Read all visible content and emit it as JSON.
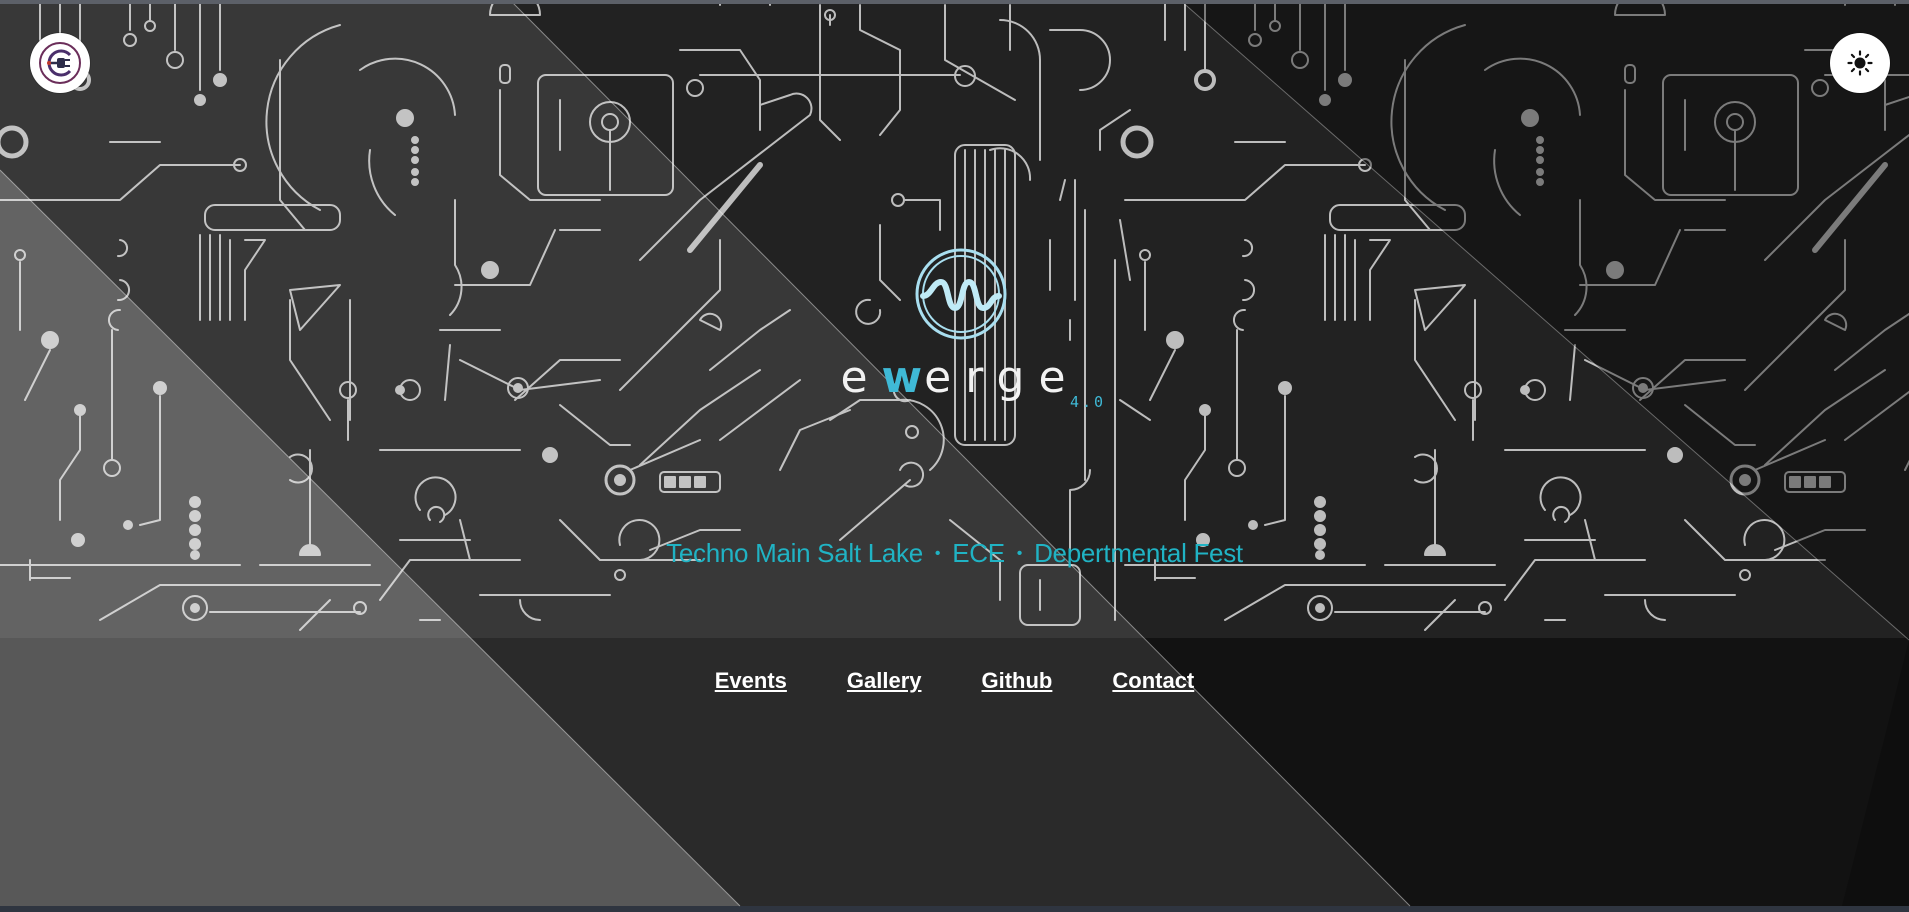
{
  "brand": {
    "mark_icon": "emerge-wave-logo",
    "word_before": "e",
    "word_highlight": "w",
    "word_after": "erge",
    "version": "4.0",
    "accent_color": "#3fb9d6"
  },
  "corner_logo": {
    "icon": "plug-logo-icon"
  },
  "theme_toggle": {
    "icon": "sun-icon"
  },
  "tagline": {
    "parts": [
      "Techno Main Salt Lake",
      "ECE",
      "Depertmental Fest"
    ],
    "separator": "•",
    "color": "#20b3c4"
  },
  "nav": {
    "items": [
      {
        "label": "Events"
      },
      {
        "label": "Gallery"
      },
      {
        "label": "Github"
      },
      {
        "label": "Contact"
      }
    ]
  },
  "colors": {
    "page_bg": "#121212",
    "hero_bg": "#222222",
    "circuit_lines": "#bdbdbd"
  }
}
